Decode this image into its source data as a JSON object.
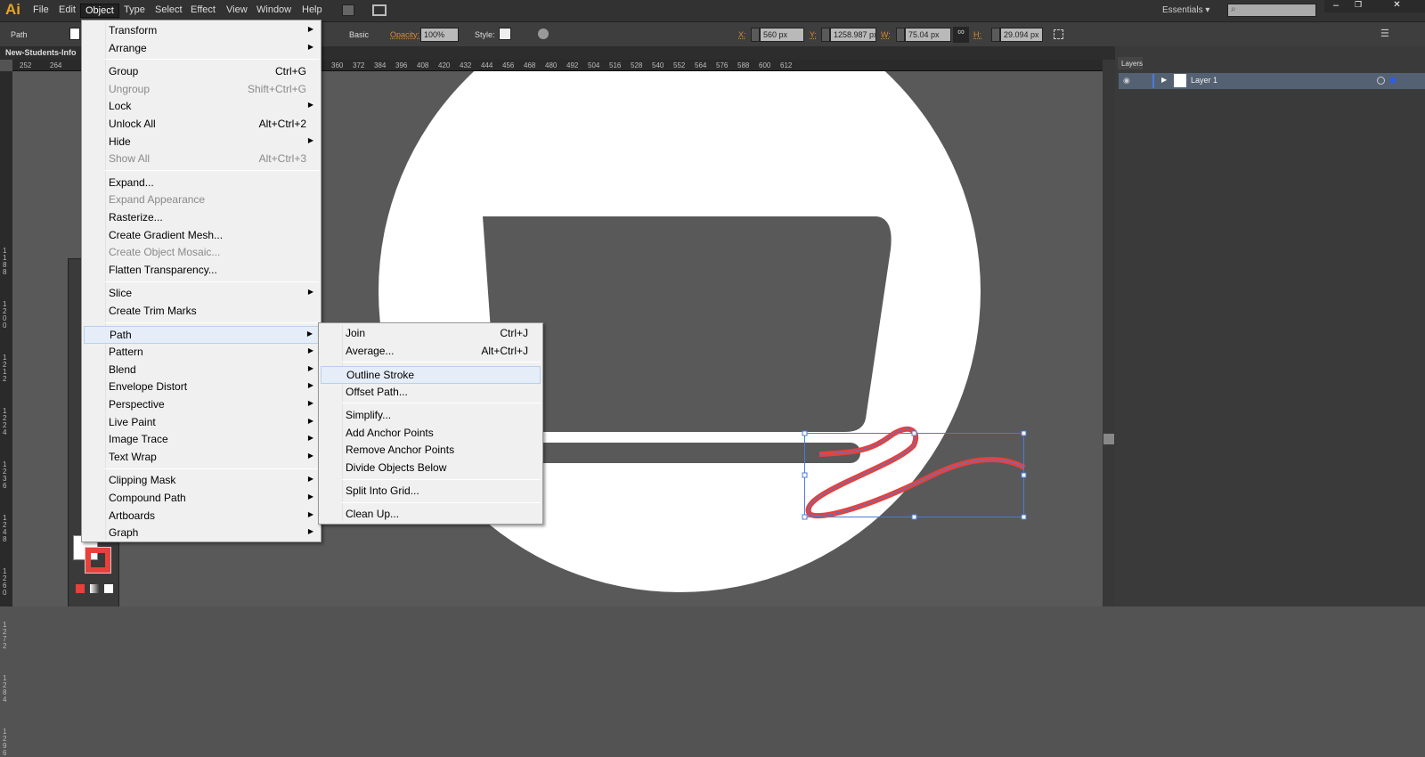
{
  "app": {
    "logo": "Ai",
    "menus": [
      "File",
      "Edit",
      "Object",
      "Type",
      "Select",
      "Effect",
      "View",
      "Window",
      "Help"
    ],
    "active_menu": "Object",
    "workspace": "Essentials",
    "search_placeholder": ""
  },
  "control": {
    "selection": "Path",
    "stroke_style": "Basic",
    "opacity_label": "Opacity:",
    "opacity": "100%",
    "style_label": "Style:",
    "x_label": "X:",
    "x": "560 px",
    "y_label": "Y:",
    "y": "1258.987 px",
    "w_label": "W:",
    "w": "75.04 px",
    "h_label": "H:",
    "h": "29.094 px"
  },
  "document": {
    "tab": "New-Students-Info"
  },
  "ruler": {
    "h_ticks": [
      "252",
      "264",
      "360",
      "372",
      "384",
      "396",
      "408",
      "420",
      "432",
      "444",
      "456",
      "468",
      "480",
      "492",
      "504",
      "516",
      "528",
      "540",
      "552",
      "564",
      "576",
      "588",
      "600",
      "612"
    ],
    "v_ticks": [
      "1188",
      "1200",
      "1212",
      "1224",
      "1236",
      "1248",
      "1260",
      "1272",
      "1284",
      "1296"
    ]
  },
  "object_menu": [
    {
      "label": "Transform",
      "sub": true
    },
    {
      "label": "Arrange",
      "sub": true
    },
    {
      "sep": true
    },
    {
      "label": "Group",
      "shortcut": "Ctrl+G"
    },
    {
      "label": "Ungroup",
      "shortcut": "Shift+Ctrl+G",
      "disabled": true
    },
    {
      "label": "Lock",
      "sub": true
    },
    {
      "label": "Unlock All",
      "shortcut": "Alt+Ctrl+2"
    },
    {
      "label": "Hide",
      "sub": true
    },
    {
      "label": "Show All",
      "shortcut": "Alt+Ctrl+3",
      "disabled": true
    },
    {
      "sep": true
    },
    {
      "label": "Expand..."
    },
    {
      "label": "Expand Appearance",
      "disabled": true
    },
    {
      "label": "Rasterize..."
    },
    {
      "label": "Create Gradient Mesh..."
    },
    {
      "label": "Create Object Mosaic...",
      "disabled": true
    },
    {
      "label": "Flatten Transparency..."
    },
    {
      "sep": true
    },
    {
      "label": "Slice",
      "sub": true
    },
    {
      "label": "Create Trim Marks"
    },
    {
      "sep": true
    },
    {
      "label": "Path",
      "sub": true,
      "highlight": true
    },
    {
      "label": "Pattern",
      "sub": true
    },
    {
      "label": "Blend",
      "sub": true
    },
    {
      "label": "Envelope Distort",
      "sub": true
    },
    {
      "label": "Perspective",
      "sub": true
    },
    {
      "label": "Live Paint",
      "sub": true
    },
    {
      "label": "Image Trace",
      "sub": true
    },
    {
      "label": "Text Wrap",
      "sub": true
    },
    {
      "sep": true
    },
    {
      "label": "Clipping Mask",
      "sub": true
    },
    {
      "label": "Compound Path",
      "sub": true
    },
    {
      "label": "Artboards",
      "sub": true
    },
    {
      "label": "Graph",
      "sub": true
    }
  ],
  "path_submenu": [
    {
      "label": "Join",
      "shortcut": "Ctrl+J"
    },
    {
      "label": "Average...",
      "shortcut": "Alt+Ctrl+J"
    },
    {
      "sep": true
    },
    {
      "label": "Outline Stroke",
      "highlight": true
    },
    {
      "label": "Offset Path..."
    },
    {
      "sep": true
    },
    {
      "label": "Simplify..."
    },
    {
      "label": "Add Anchor Points"
    },
    {
      "label": "Remove Anchor Points"
    },
    {
      "label": "Divide Objects Below"
    },
    {
      "sep": true
    },
    {
      "label": "Split Into Grid..."
    },
    {
      "sep": true
    },
    {
      "label": "Clean Up..."
    }
  ],
  "layers": {
    "title": "Layers",
    "items": [
      {
        "name": "Layer 1"
      }
    ]
  },
  "colors": {
    "accent": "#4a7bd8",
    "stroke": "#e8403a"
  }
}
